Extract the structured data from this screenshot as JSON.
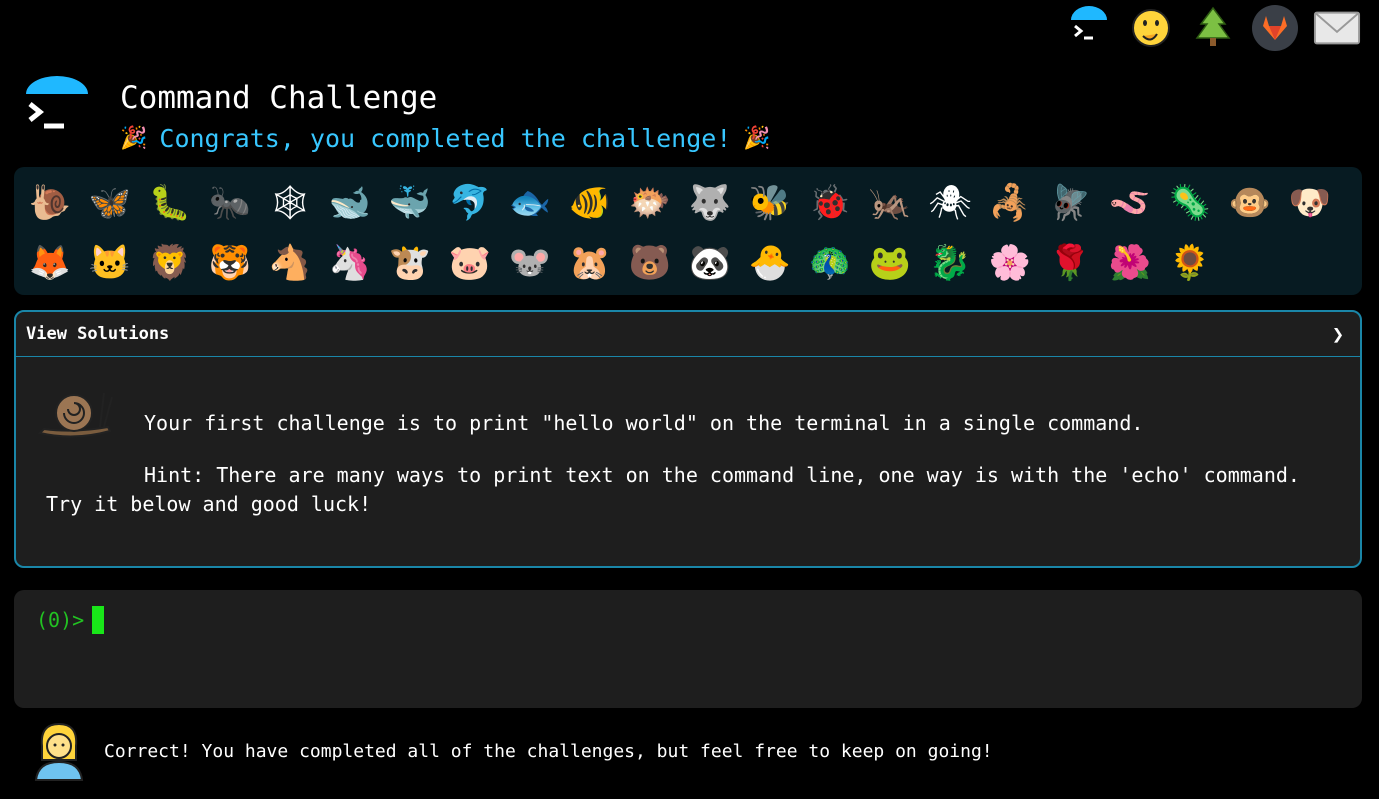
{
  "header": {
    "title": "Command Challenge",
    "subtitle": "Congrats, you completed the challenge!"
  },
  "topnav": {
    "items": [
      {
        "icon": "terminal-logo-icon"
      },
      {
        "icon": "face-with-hand-over-mouth-icon",
        "glyph": "🤭"
      },
      {
        "icon": "christmas-tree-icon",
        "glyph": "🌲"
      },
      {
        "icon": "gitlab-icon"
      },
      {
        "icon": "envelope-icon"
      }
    ]
  },
  "badges": [
    {
      "name": "snail",
      "glyph": "🐌"
    },
    {
      "name": "butterfly",
      "glyph": "🦋"
    },
    {
      "name": "caterpillar",
      "glyph": "🐛"
    },
    {
      "name": "ant",
      "glyph": "🐜"
    },
    {
      "name": "spider-web",
      "glyph": "🕸"
    },
    {
      "name": "whale",
      "glyph": "🐋"
    },
    {
      "name": "whale-spouting",
      "glyph": "🐳"
    },
    {
      "name": "dolphin",
      "glyph": "🐬"
    },
    {
      "name": "fish",
      "glyph": "🐟"
    },
    {
      "name": "tropical-fish",
      "glyph": "🐠"
    },
    {
      "name": "blowfish",
      "glyph": "🐡"
    },
    {
      "name": "wolf",
      "glyph": "🐺"
    },
    {
      "name": "bee",
      "glyph": "🐝"
    },
    {
      "name": "lady-beetle",
      "glyph": "🐞"
    },
    {
      "name": "cricket",
      "glyph": "🦗"
    },
    {
      "name": "spider",
      "glyph": "🕷"
    },
    {
      "name": "scorpion",
      "glyph": "🦂"
    },
    {
      "name": "fly",
      "glyph": "🪰"
    },
    {
      "name": "worm",
      "glyph": "🪱"
    },
    {
      "name": "microbe",
      "glyph": "🦠"
    },
    {
      "name": "monkey",
      "glyph": "🐵"
    },
    {
      "name": "dog",
      "glyph": "🐶"
    },
    {
      "name": "fox",
      "glyph": "🦊"
    },
    {
      "name": "cat",
      "glyph": "🐱"
    },
    {
      "name": "lion",
      "glyph": "🦁"
    },
    {
      "name": "tiger",
      "glyph": "🐯"
    },
    {
      "name": "horse",
      "glyph": "🐴"
    },
    {
      "name": "unicorn",
      "glyph": "🦄"
    },
    {
      "name": "cow",
      "glyph": "🐮"
    },
    {
      "name": "pig",
      "glyph": "🐷"
    },
    {
      "name": "mouse",
      "glyph": "🐭"
    },
    {
      "name": "hamster",
      "glyph": "🐹"
    },
    {
      "name": "bear",
      "glyph": "🐻"
    },
    {
      "name": "panda",
      "glyph": "🐼"
    },
    {
      "name": "hatching-chick",
      "glyph": "🐣"
    },
    {
      "name": "peacock",
      "glyph": "🦚"
    },
    {
      "name": "frog",
      "glyph": "🐸"
    },
    {
      "name": "dragon",
      "glyph": "🐉"
    },
    {
      "name": "cherry-blossom",
      "glyph": "🌸"
    },
    {
      "name": "rose",
      "glyph": "🌹"
    },
    {
      "name": "hibiscus",
      "glyph": "🌺"
    },
    {
      "name": "sunflower",
      "glyph": "🌻"
    }
  ],
  "solutions": {
    "label": "View Solutions",
    "chevron": "❯",
    "para1": "Your first challenge is to print \"hello world\" on the terminal in a single command.",
    "para2": "Hint: There are many ways to print text on the command line, one way is with the 'echo' command. Try it below and good luck!"
  },
  "terminal": {
    "prompt": "(0)>"
  },
  "footer": {
    "message": "Correct! You have completed all of the challenges, but feel free to keep on going!"
  },
  "colors": {
    "accent": "#38c7ff",
    "panel_border": "#1a86a8",
    "prompt": "#22c222",
    "cursor": "#19e619"
  }
}
